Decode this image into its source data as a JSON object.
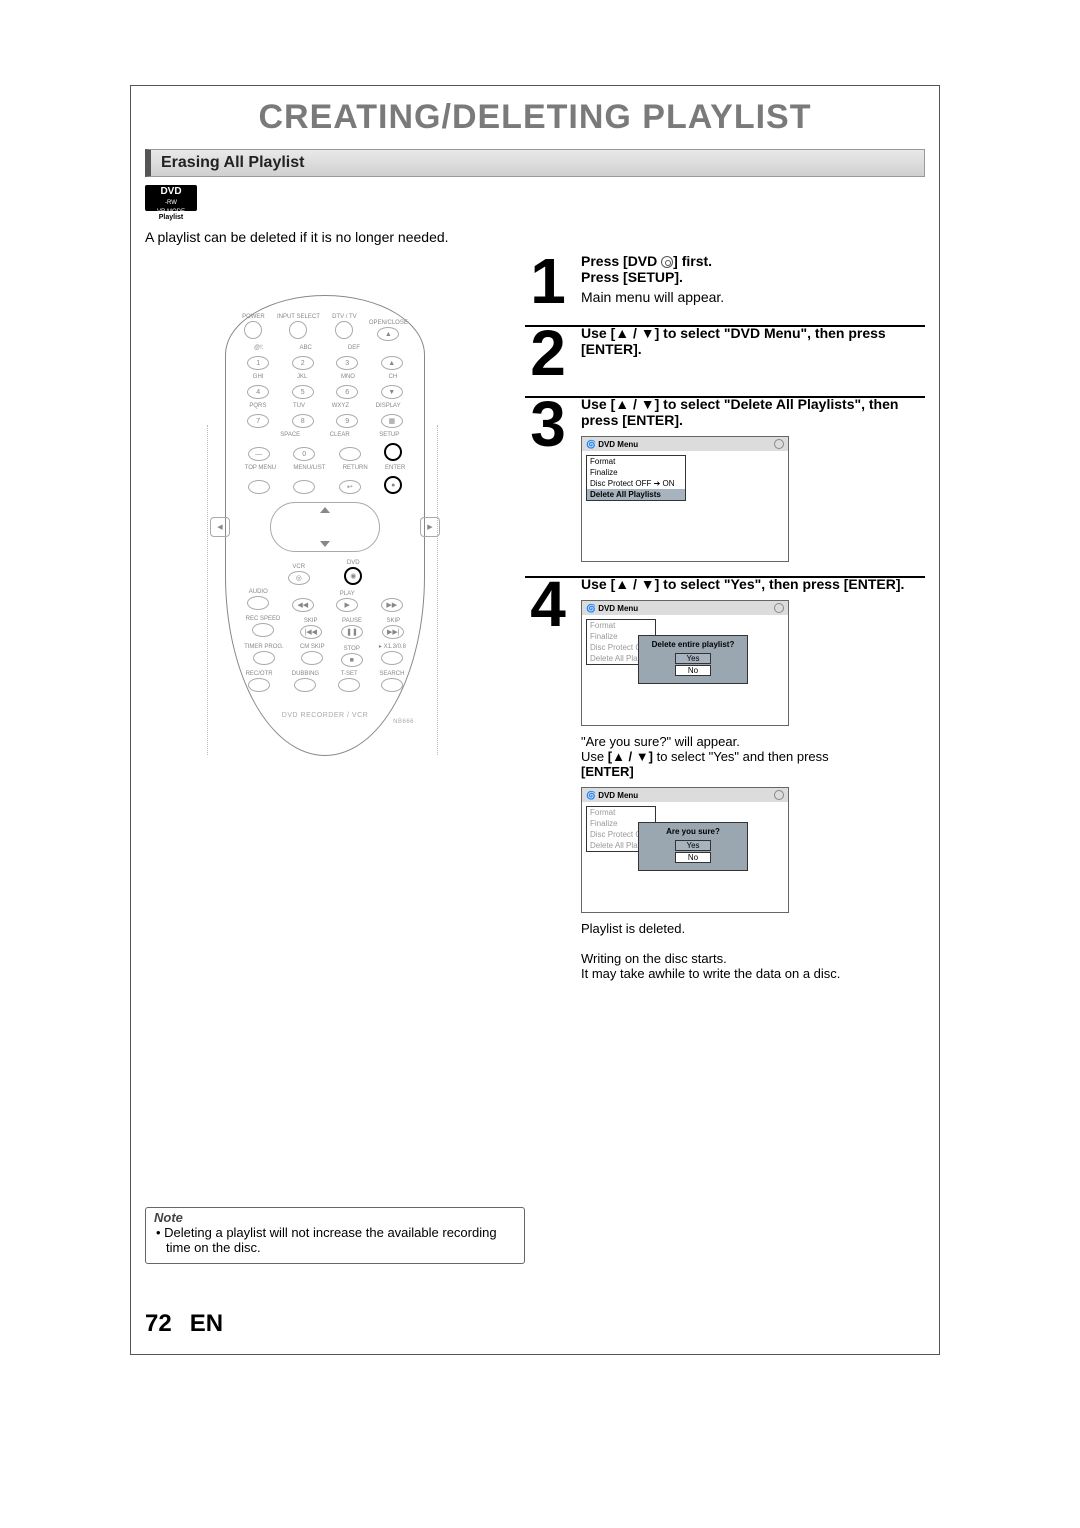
{
  "title": "CREATING/DELETING PLAYLIST",
  "section": "Erasing All Playlist",
  "badge": {
    "line1": "DVD",
    "line2": "-RW",
    "line3": "VR MODE",
    "sub": "Playlist"
  },
  "intro": "A playlist can be deleted if it is no longer needed.",
  "remote": {
    "row1": [
      "POWER",
      "INPUT SELECT",
      "DTV / TV",
      "OPEN/CLOSE"
    ],
    "abc": [
      "@!:",
      "ABC",
      "DEF"
    ],
    "num1": [
      "1",
      "2",
      "3"
    ],
    "ghi": [
      "GHI",
      "JKL",
      "MNO"
    ],
    "num2": [
      "4",
      "5",
      "6"
    ],
    "pqr": [
      "PQRS",
      "TUV",
      "WXYZ"
    ],
    "num3": [
      "7",
      "8",
      "9"
    ],
    "space": [
      "",
      "SPACE",
      "CLEAR"
    ],
    "num4": [
      "—",
      "0",
      ""
    ],
    "ch": "CH",
    "display": "DISPLAY",
    "setup": "SETUP",
    "enter": "ENTER",
    "menus": [
      "TOP MENU",
      "MENU/LIST",
      "RETURN"
    ],
    "vcr": "VCR",
    "dvd": "DVD",
    "audio": "AUDIO",
    "play": "PLAY",
    "transport": [
      "REC SPEED",
      "SKIP",
      "PAUSE",
      "SKIP"
    ],
    "row_timer": [
      "TIMER PROG.",
      "CM SKIP",
      "STOP",
      "▸ X1.3/0.8"
    ],
    "row_rec": [
      "REC/OTR",
      "DUBBING",
      "T-SET",
      "SEARCH"
    ],
    "brand": "DVD RECORDER / VCR",
    "model": "NB666"
  },
  "steps": {
    "s1": {
      "line1a": "Press [DVD ",
      "line1b": "] first.",
      "line2": "Press [SETUP].",
      "line3": "Main menu will appear."
    },
    "s2": {
      "line1": "Use [▲ / ▼] to select \"DVD Menu\", then press [ENTER]."
    },
    "s3": {
      "line1": "Use [▲ / ▼] to select \"Delete All Playlists\", then press [ENTER].",
      "menu_title": "DVD Menu",
      "menu_items": [
        "Format",
        "Finalize",
        "Disc Protect OFF ➔ ON",
        "Delete All Playlists"
      ]
    },
    "s4": {
      "line1": "Use [▲ / ▼] to select \"Yes\", then press [ENTER].",
      "menu_title": "DVD Menu",
      "menu_side": [
        "Format",
        "Finalize",
        "Disc Protect OFF",
        "Delete All Playl"
      ],
      "dialog1_q": "Delete entire playlist?",
      "yes": "Yes",
      "no": "No",
      "follow1": "\"Are you sure?\" will appear.",
      "follow2a": "Use ",
      "follow2b": "[▲ / ▼]",
      "follow2c": " to select \"Yes\" and then press ",
      "follow2d": "[ENTER]",
      "dialog2_q": "Are you sure?",
      "after1": "Playlist is deleted.",
      "after2": "Writing on the disc starts.",
      "after3": "It may take awhile to write the data on a disc."
    }
  },
  "note": {
    "hdr": "Note",
    "body": "• Deleting a playlist will not increase the available recording time on the disc."
  },
  "pagenum": "72",
  "lang": "EN"
}
